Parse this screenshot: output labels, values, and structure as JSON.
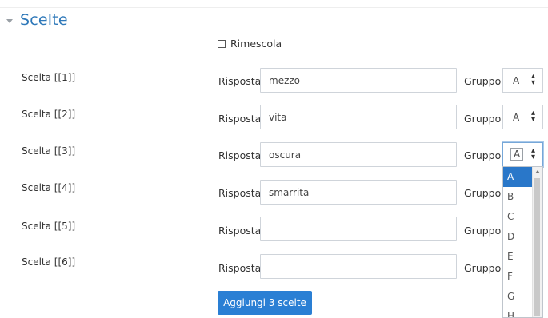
{
  "section": {
    "title": "Scelte",
    "toggle_icon": "chevron-down-icon"
  },
  "shuffle": {
    "label": "Rimescola",
    "checked": false
  },
  "answer_label": "Risposta",
  "group_label": "Gruppo",
  "choices": [
    {
      "label": "Scelta [[1]]",
      "answer": "mezzo",
      "group": "A"
    },
    {
      "label": "Scelta [[2]]",
      "answer": "vita",
      "group": "A"
    },
    {
      "label": "Scelta [[3]]",
      "answer": "oscura",
      "group": "A"
    },
    {
      "label": "Scelta [[4]]",
      "answer": "smarrita",
      "group": ""
    },
    {
      "label": "Scelta [[5]]",
      "answer": "",
      "group": ""
    },
    {
      "label": "Scelta [[6]]",
      "answer": "",
      "group": ""
    }
  ],
  "group_dropdown": {
    "options": [
      "A",
      "B",
      "C",
      "D",
      "E",
      "F",
      "G",
      "H"
    ],
    "selected": "A"
  },
  "add_button": {
    "label": "Aggiungi 3 scelte"
  },
  "colors": {
    "section_title": "#2e78b9",
    "button_bg": "#2a7fd4",
    "dropdown_selected": "#2977c9"
  }
}
